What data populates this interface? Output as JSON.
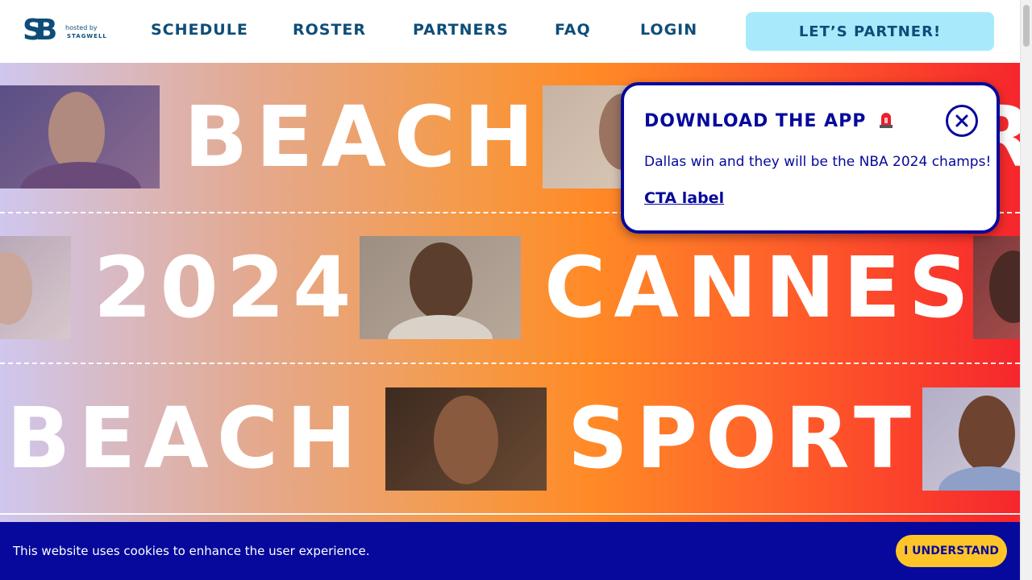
{
  "header": {
    "logo_mark": "SB",
    "hosted_by": "hosted by",
    "host_name": "STAGWELL",
    "nav": [
      {
        "label": "SCHEDULE"
      },
      {
        "label": "ROSTER"
      },
      {
        "label": "PARTNERS"
      },
      {
        "label": "FAQ"
      },
      {
        "label": "LOGIN"
      }
    ],
    "cta_label": "LET’S PARTNER!"
  },
  "hero": {
    "row1": [
      "BEACH",
      "R"
    ],
    "row2": [
      "2024",
      "CANNES"
    ],
    "row3": [
      "BEACH",
      "SPORT"
    ]
  },
  "popup": {
    "title": "DOWNLOAD THE APP",
    "icon": "siren-icon",
    "body": "Dallas win and they will be the NBA 2024 champs!",
    "link": "CTA label"
  },
  "cookie": {
    "text": "This website uses cookies to enhance the user experience.",
    "button": "I UNDERSTAND"
  },
  "colors": {
    "brand_navy": "#0e4d78",
    "popup_blue": "#06099b",
    "cta_cyan": "#a8eafc",
    "cookie_yellow": "#ffc528"
  }
}
